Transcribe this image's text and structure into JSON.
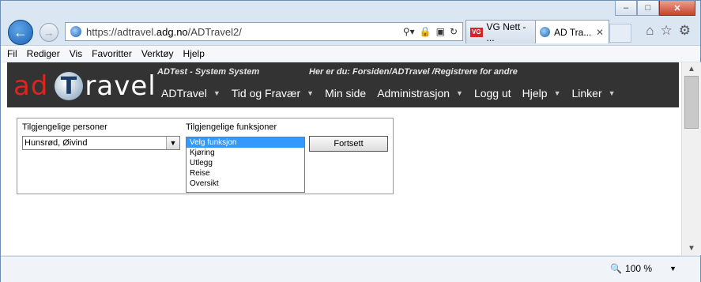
{
  "window": {
    "minimize": "‒",
    "maximize": "□",
    "close": "✕"
  },
  "nav": {
    "back": "←",
    "forward": "→",
    "url_prefix": "https://adtravel.",
    "url_domain": "adg.no",
    "url_suffix": "/ADTravel2/"
  },
  "tabs": [
    {
      "label": "VG Nett - ...",
      "favicon": "VG"
    },
    {
      "label": "AD Tra...",
      "close": "✕"
    }
  ],
  "toolbar_icons": [
    "home-icon",
    "star-icon",
    "gear-icon"
  ],
  "menubar": [
    "Fil",
    "Rediger",
    "Vis",
    "Favoritter",
    "Verktøy",
    "Hjelp"
  ],
  "app": {
    "logo_ad": "ad",
    "logo_travel": "ravel",
    "system_text": "ADTest - System System",
    "breadcrumb": "Her er du: Forsiden/ADTravel /Registrere for andre",
    "menu": [
      {
        "label": "ADTravel",
        "caret": true
      },
      {
        "label": "Tid og Fravær",
        "caret": true
      },
      {
        "label": "Min side",
        "caret": false
      },
      {
        "label": "Administrasjon",
        "caret": true
      },
      {
        "label": "Logg ut",
        "caret": false
      },
      {
        "label": "Hjelp",
        "caret": true
      },
      {
        "label": "Linker",
        "caret": true
      }
    ]
  },
  "form": {
    "persons_label": "Tilgjengelige personer",
    "persons_value": "Hunsrød, Øivind",
    "functions_label": "Tilgjengelige funksjoner",
    "functions": [
      "Velg funksjon",
      "Kjøring",
      "Utlegg",
      "Reise",
      "Oversikt"
    ],
    "selected_function": "Velg funksjon",
    "submit_label": "Fortsett"
  },
  "status": {
    "zoom": "100 %"
  }
}
